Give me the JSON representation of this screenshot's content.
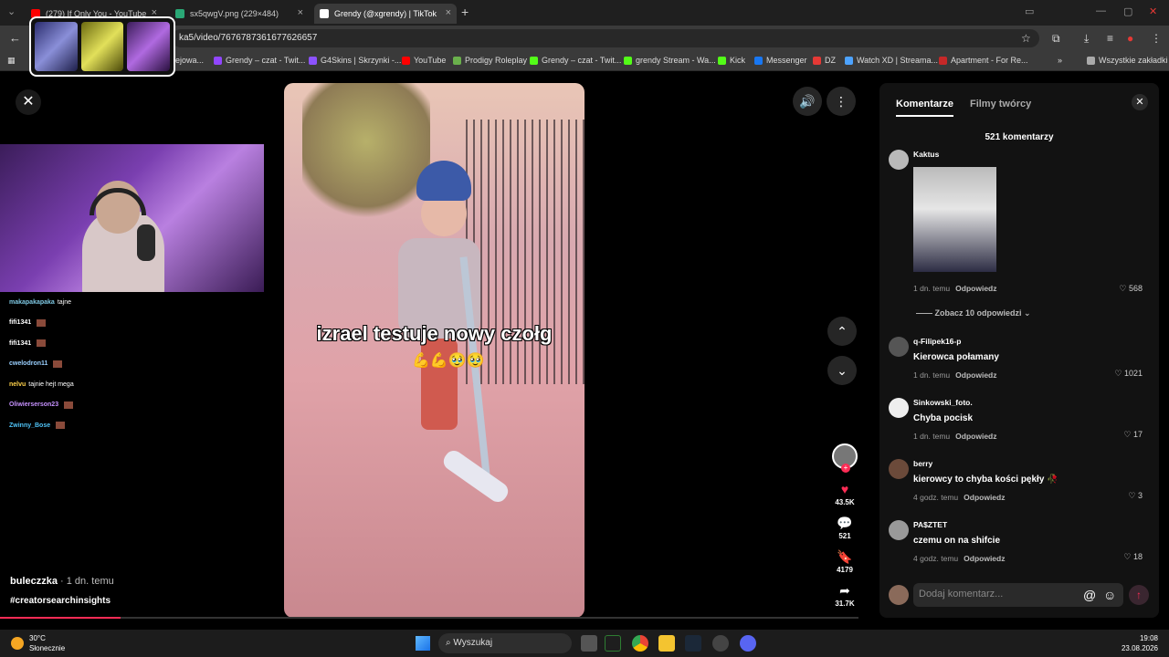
{
  "browser": {
    "tabs": [
      {
        "label": "(279) If Only You - YouTube",
        "color": "#ff0000"
      },
      {
        "label": "sx5qwgV.png (229×484)",
        "color": "#2aa876"
      },
      {
        "label": "Grendy (@xgrendy) | TikTok",
        "color": "#ffffff"
      }
    ],
    "new_tab": "+",
    "url": "ka5/video/7676787361677626657",
    "bookmarks": [
      {
        "label": "ejowa...",
        "color": "#666666"
      },
      {
        "label": "Grendy – czat - Twit...",
        "color": "#9146ff"
      },
      {
        "label": "G4Skins | Skrzynki -...",
        "color": "#8c52ff"
      },
      {
        "label": "YouTube",
        "color": "#ff0000"
      },
      {
        "label": "Prodigy Roleplay",
        "color": "#6ab04c"
      },
      {
        "label": "Grendy – czat - Twit...",
        "color": "#53fc18"
      },
      {
        "label": "grendy Stream - Wa...",
        "color": "#53fc18"
      },
      {
        "label": "Kick",
        "color": "#53fc18"
      },
      {
        "label": "Messenger",
        "color": "#1877f2"
      },
      {
        "label": "DZ",
        "color": "#e53935"
      },
      {
        "label": "Watch XD | Streama...",
        "color": "#4da3ff"
      },
      {
        "label": "Apartment - For Re...",
        "color": "#c62828"
      }
    ],
    "all_bookmarks": "Wszystkie zakładki"
  },
  "chat": [
    {
      "user": "makapakapaka",
      "msg": "tajne",
      "color": "#7ec8e3"
    },
    {
      "user": "fifi1341",
      "msg": "",
      "color": "#ffffff"
    },
    {
      "user": "fifi1341",
      "msg": "",
      "color": "#ffffff"
    },
    {
      "user": "cwelodron11",
      "msg": "",
      "color": "#9ad0ff"
    },
    {
      "user": "nelvu",
      "msg": "tajnie hejt mega",
      "color": "#ffd24a"
    },
    {
      "user": "Oliwierserson23",
      "msg": "",
      "color": "#c792ff"
    },
    {
      "user": "Zwinny_Bose",
      "msg": "",
      "color": "#4fc3f7"
    }
  ],
  "video": {
    "caption": "izrael testuje nowy czołg",
    "emoji": "💪💪🥹🥹",
    "author": "buleczzka",
    "time": "· 1 dn. temu",
    "hashtag": "#creatorsearchinsights",
    "progress": 0.14
  },
  "actions": {
    "likes": "43.5K",
    "comments": "521",
    "saves": "4179",
    "shares": "31.7K"
  },
  "panel": {
    "tab_comments": "Komentarze",
    "tab_creator": "Filmy twórcy",
    "count": "521 komentarzy",
    "see_replies": "Zobacz 10 odpowiedzi",
    "add_placeholder": "Dodaj komentarz...",
    "comments": [
      {
        "name": "Kaktus",
        "text": "",
        "time": "1 dn. temu",
        "reply": "Odpowiedz",
        "likes": "568"
      },
      {
        "name": "q-Filipek16-p",
        "text": "Kierowca połamany",
        "time": "1 dn. temu",
        "reply": "Odpowiedz",
        "likes": "1021"
      },
      {
        "name": "Sinkowski_foto.",
        "text": "Chyba pocisk",
        "time": "1 dn. temu",
        "reply": "Odpowiedz",
        "likes": "17"
      },
      {
        "name": "berry",
        "text": "kierowcy to chyba kości pękły 🥀",
        "time": "4 godz. temu",
        "reply": "Odpowiedz",
        "likes": "3"
      },
      {
        "name": "PA$ZTET",
        "text": "czemu on na shifcie",
        "time": "4 godz. temu",
        "reply": "Odpowiedz",
        "likes": "18"
      }
    ]
  },
  "taskbar": {
    "temp": "30°C",
    "weather": "Słonecznie",
    "search": "Wyszukaj",
    "time": "19:08",
    "date": "23.08.2026"
  }
}
